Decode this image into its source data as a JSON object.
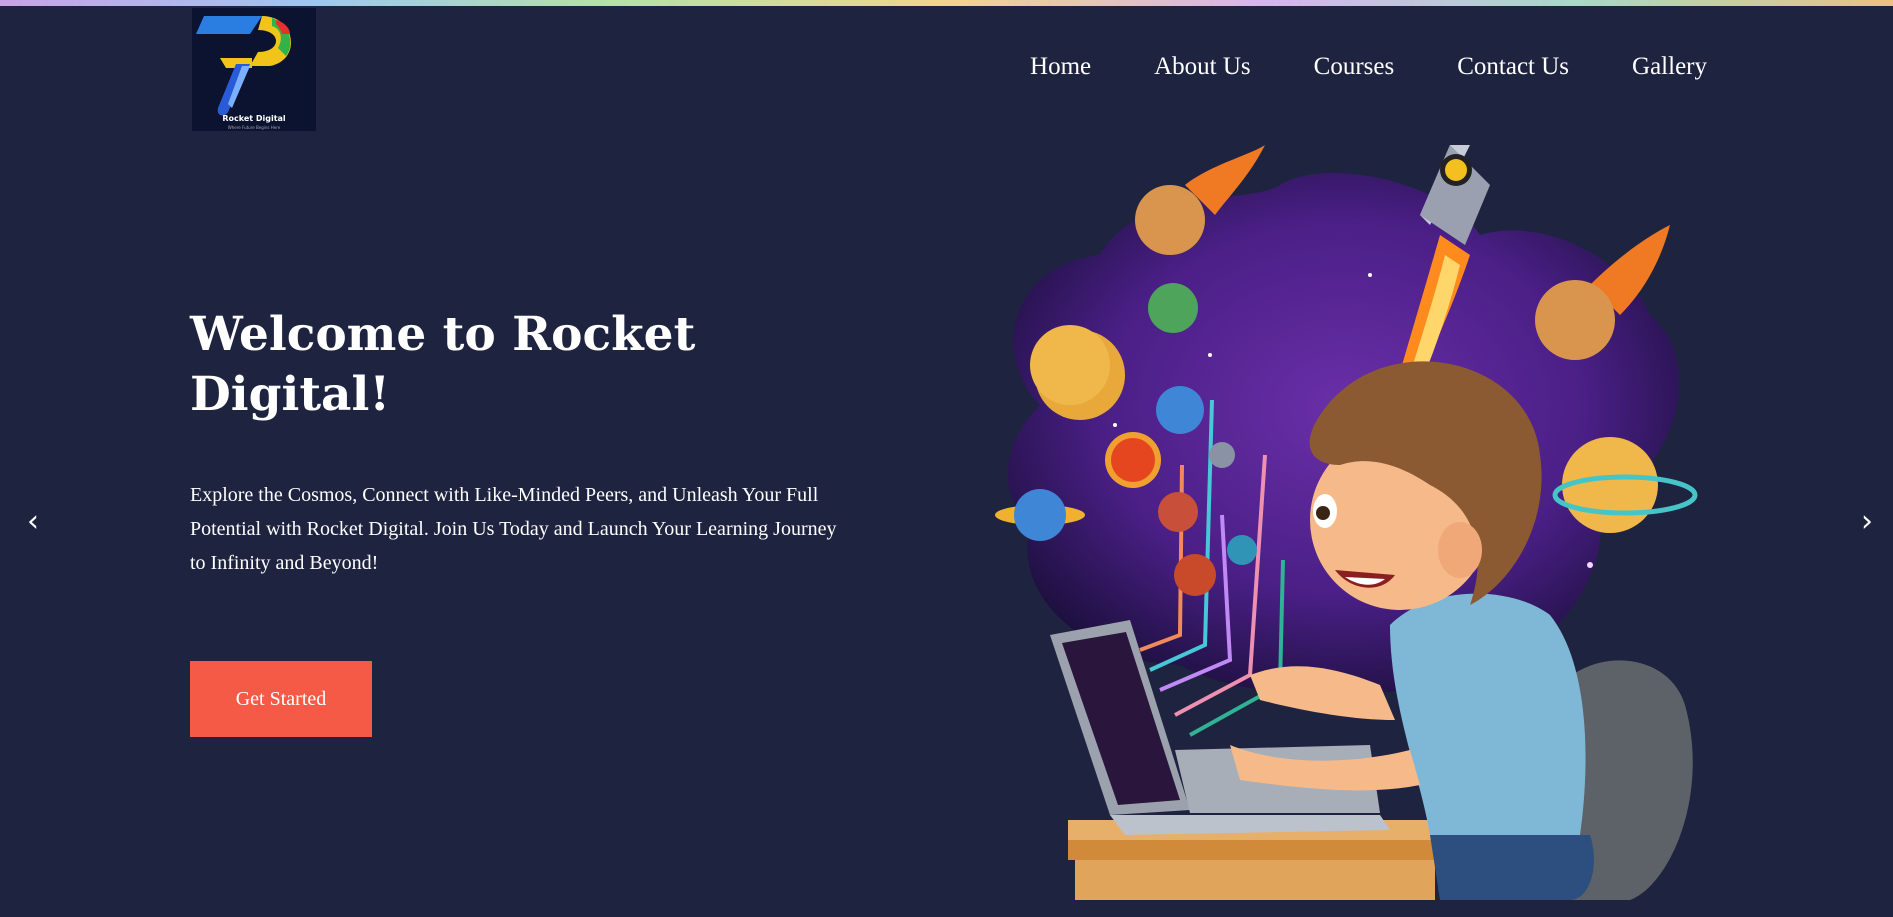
{
  "logo": {
    "text": "Rocket Digital",
    "tagline": "Where Future Begins Here"
  },
  "nav": {
    "items": [
      {
        "label": "Home"
      },
      {
        "label": "About Us"
      },
      {
        "label": "Courses"
      },
      {
        "label": "Contact Us"
      },
      {
        "label": "Gallery"
      }
    ]
  },
  "hero": {
    "title": "Welcome to Rocket Digital!",
    "text": "Explore the Cosmos, Connect with Like-Minded Peers, and Unleash Your Full Potential with Rocket Digital. Join Us Today and Launch Your Learning Journey to Infinity and Beyond!",
    "cta_label": "Get Started"
  },
  "carousel": {
    "prev_icon": "‹",
    "next_icon": "›"
  },
  "colors": {
    "background": "#1e2440",
    "accent": "#f55a46"
  }
}
